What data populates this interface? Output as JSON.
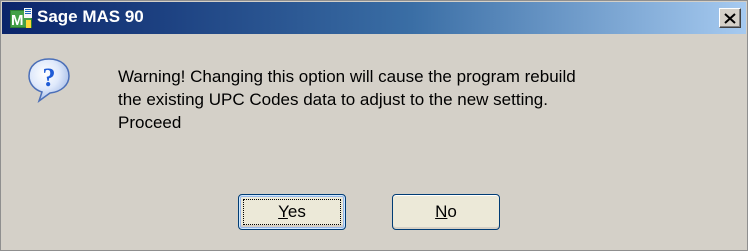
{
  "window": {
    "title": "Sage MAS 90",
    "close_glyph": "✕"
  },
  "dialog": {
    "icon": "question-icon",
    "message_lines": [
      "Warning! Changing this option will cause the program rebuild",
      "the existing UPC Codes data to adjust to the new setting.",
      "Proceed"
    ]
  },
  "buttons": {
    "yes": {
      "mnemonic": "Y",
      "rest": "es",
      "label": "Yes",
      "default": true
    },
    "no": {
      "mnemonic": "N",
      "rest": "o",
      "label": "No",
      "default": false
    }
  },
  "colors": {
    "titlebar_start": "#0a246a",
    "titlebar_end": "#a6caf0",
    "dialog_bg": "#d4d0c8",
    "icon_blue": "#1e5bd6"
  }
}
